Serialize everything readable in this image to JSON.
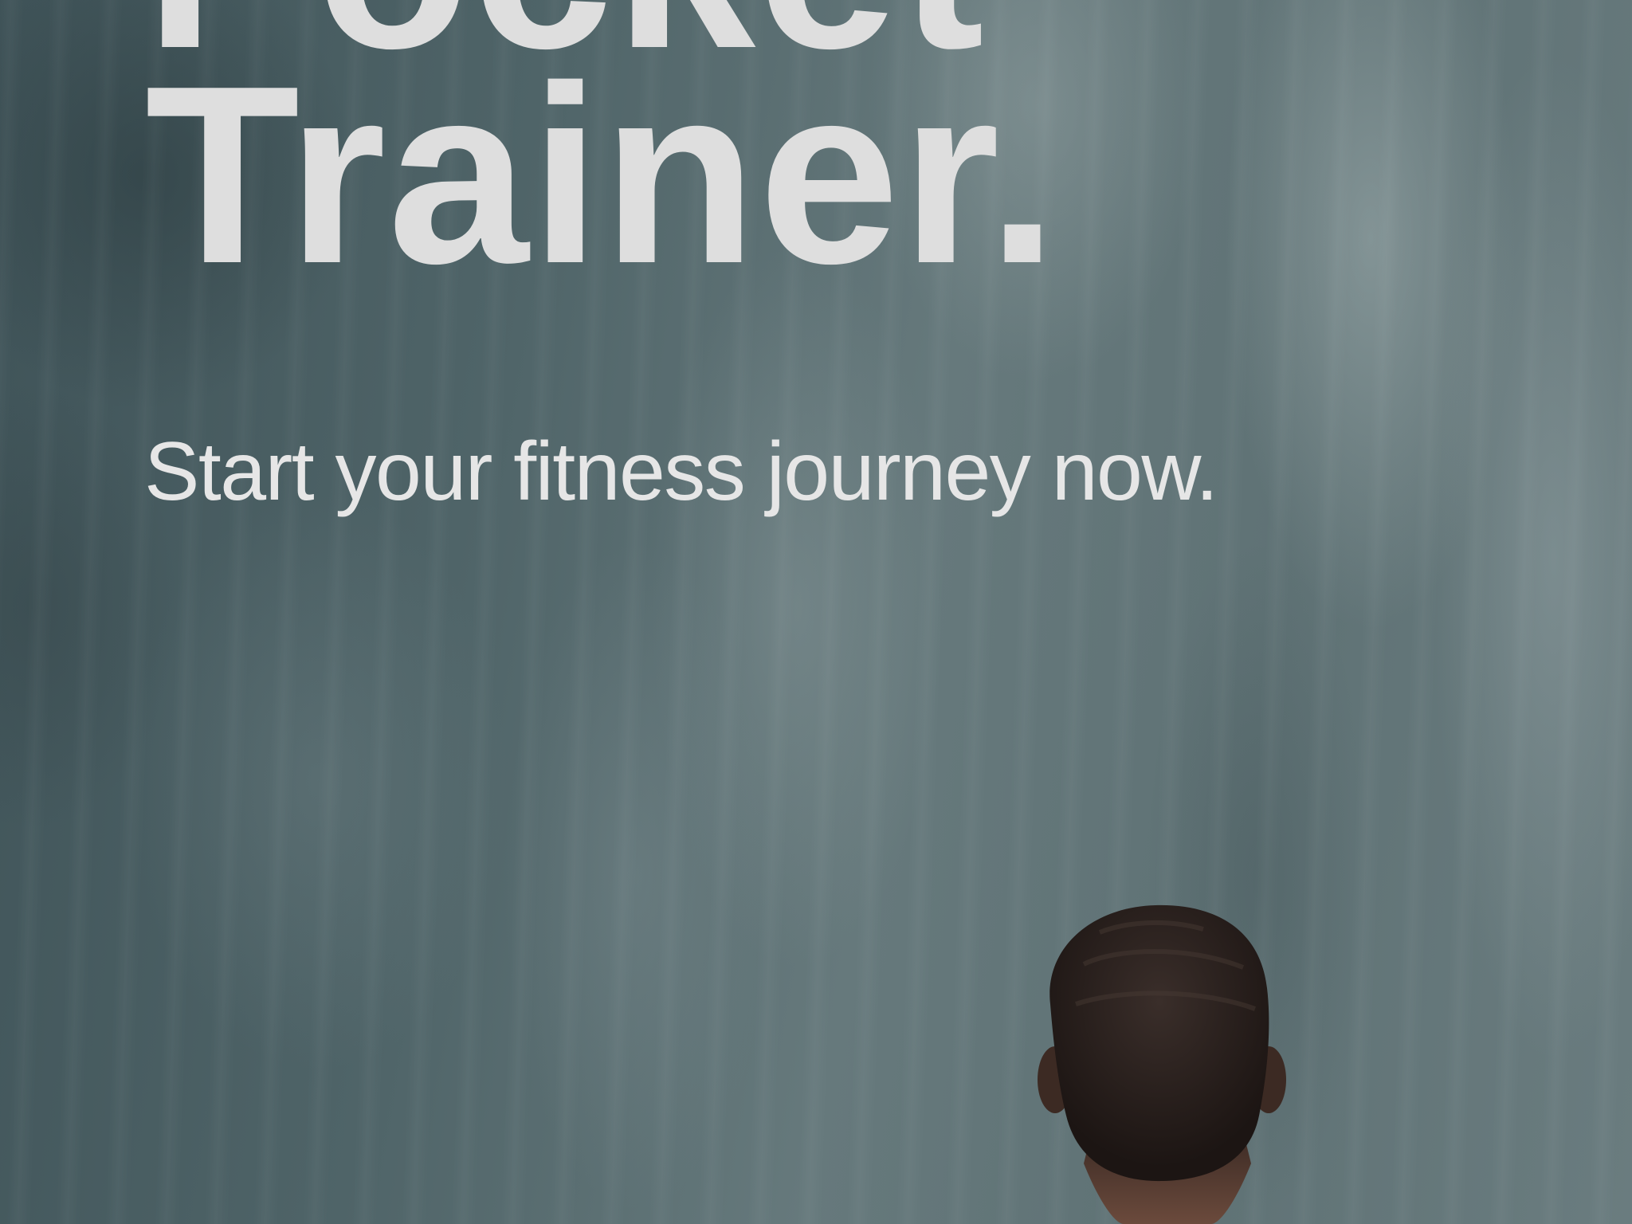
{
  "hero": {
    "title_line_1": "Pocket",
    "title_line_2": "Trainer.",
    "tagline": "Start your fitness journey now."
  },
  "colors": {
    "title_text": "#dedede",
    "tagline_text": "#e6e6e6",
    "background_mist": "#5f7275",
    "hair": "#231a17",
    "skin": "#6b4a3c"
  },
  "background": {
    "subject": "person-from-behind-facing-waterfall"
  }
}
